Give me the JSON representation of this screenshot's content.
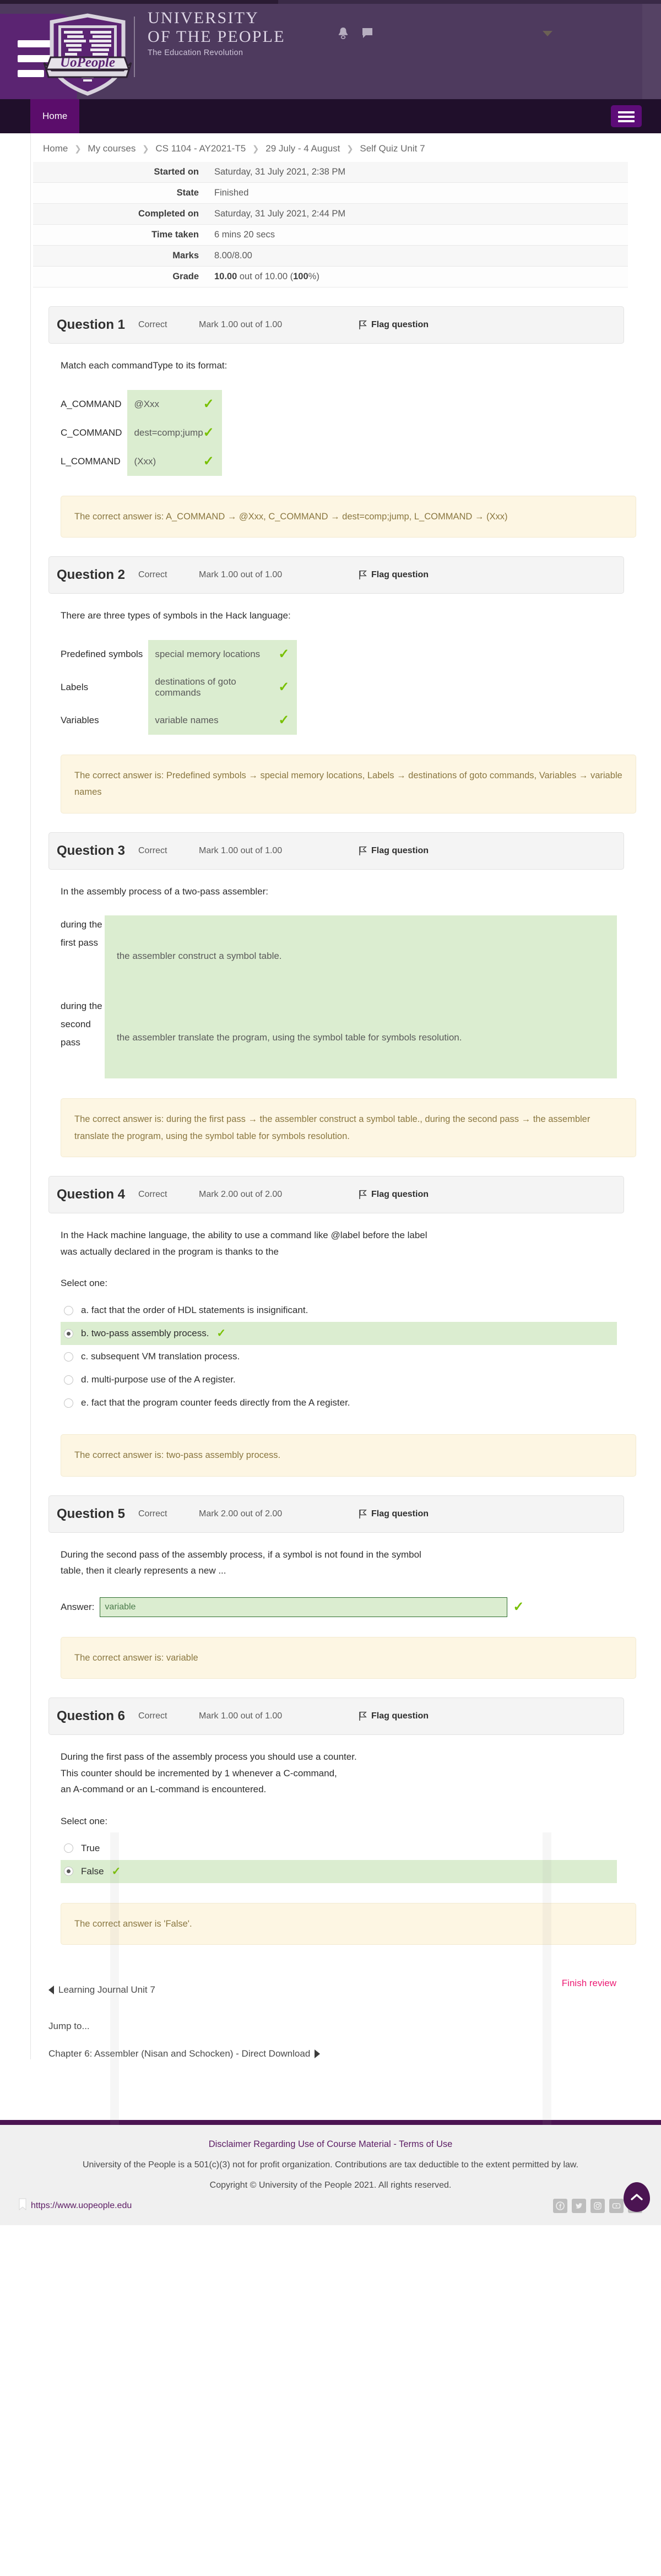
{
  "header": {
    "brand_line1": "UNIVERSITY",
    "brand_line2": "OF THE PEOPLE",
    "tagline": "The Education Revolution",
    "logo_text": "UoPeople",
    "icons": [
      "bell-icon",
      "message-icon",
      "chevron-down-icon"
    ]
  },
  "nav": {
    "home_label": "Home",
    "menu_icon": "hamburger-icon"
  },
  "breadcrumb": [
    "Home",
    "My courses",
    "CS 1104 - AY2021-T5",
    "29 July - 4 August",
    "Self Quiz Unit 7"
  ],
  "summary": {
    "rows": [
      {
        "label": "Started on",
        "value": "Saturday, 31 July 2021, 2:38 PM"
      },
      {
        "label": "State",
        "value": "Finished"
      },
      {
        "label": "Completed on",
        "value": "Saturday, 31 July 2021, 2:44 PM"
      },
      {
        "label": "Time taken",
        "value": "6 mins 20 secs"
      },
      {
        "label": "Marks",
        "value": "8.00/8.00"
      }
    ],
    "grade": {
      "label": "Grade",
      "value_bold": "10.00",
      "value_mid": " out of 10.00 (",
      "value_pct": "100",
      "value_end": "%)"
    }
  },
  "common": {
    "state_correct": "Correct",
    "flag_label": "Flag question",
    "select_one": "Select one:",
    "answer_label": "Answer:"
  },
  "questions": [
    {
      "number": "Question 1",
      "state": "Correct",
      "mark": "Mark 1.00 out of 1.00",
      "flag": "Flag question",
      "prompt": "Match each commandType to its format:",
      "type": "match",
      "pairs": [
        {
          "key": "A_COMMAND",
          "value": "@Xxx"
        },
        {
          "key": "C_COMMAND",
          "value": "dest=comp;jump"
        },
        {
          "key": "L_COMMAND",
          "value": "(Xxx)"
        }
      ],
      "feedback": "The correct answer is: A_COMMAND → @Xxx, C_COMMAND → dest=comp;jump, L_COMMAND → (Xxx)"
    },
    {
      "number": "Question 2",
      "state": "Correct",
      "mark": "Mark 1.00 out of 1.00",
      "flag": "Flag question",
      "prompt": "There are three types of symbols in the Hack language:",
      "type": "match",
      "pairs": [
        {
          "key": "Predefined symbols",
          "value": "special memory locations"
        },
        {
          "key": "Labels",
          "value": "destinations of goto commands"
        },
        {
          "key": "Variables",
          "value": "variable names"
        }
      ],
      "feedback": "The correct answer is: Predefined symbols → special memory locations, Labels → destinations of goto commands, Variables → variable names"
    },
    {
      "number": "Question 3",
      "state": "Correct",
      "mark": "Mark 1.00 out of 1.00",
      "flag": "Flag question",
      "prompt": "In the assembly process of a two-pass assembler:",
      "type": "match-wrap",
      "pairs": [
        {
          "key": "during the first pass",
          "value": "the assembler construct a symbol table."
        },
        {
          "key": "during the second pass",
          "value": "the assembler translate the program, using the symbol table for symbols resolution."
        }
      ],
      "feedback": "The correct answer is: during the first pass → the assembler construct a symbol table., during the second pass → the assembler translate the program, using the symbol table for symbols resolution."
    },
    {
      "number": "Question 4",
      "state": "Correct",
      "mark": "Mark 2.00 out of 2.00",
      "flag": "Flag question",
      "prompt_line1": "In the Hack machine language, the ability to use a command like @label before the label",
      "prompt_line2": "was actually declared in the program is thanks to the",
      "type": "radio",
      "select_one": "Select one:",
      "options": [
        {
          "label": "a. fact that the order of HDL statements is insignificant.",
          "selected": false,
          "correct": false
        },
        {
          "label": "b. two-pass assembly process.",
          "selected": true,
          "correct": true
        },
        {
          "label": "c. subsequent VM translation process.",
          "selected": false,
          "correct": false
        },
        {
          "label": "d. multi-purpose use of the A register.",
          "selected": false,
          "correct": false
        },
        {
          "label": "e. fact that the program counter feeds directly from the A register.",
          "selected": false,
          "correct": false
        }
      ],
      "feedback": "The correct answer is: two-pass assembly process."
    },
    {
      "number": "Question 5",
      "state": "Correct",
      "mark": "Mark 2.00 out of 2.00",
      "flag": "Flag question",
      "prompt_line1": "During the second pass of the assembly process, if a symbol is not found in the symbol",
      "prompt_line2": "table, then it clearly represents a new ...",
      "type": "shortanswer",
      "answer_label": "Answer:",
      "answer_value": "variable",
      "feedback": "The correct answer is: variable"
    },
    {
      "number": "Question 6",
      "state": "Correct",
      "mark": "Mark 1.00 out of 1.00",
      "flag": "Flag question",
      "prompt_line1": "During the first pass of the assembly process you should use a counter.",
      "prompt_line2": "This counter should be incremented by 1 whenever a C-command,",
      "prompt_line3": "an A-command or an L-command is encountered.",
      "type": "radio",
      "select_one": "Select one:",
      "options": [
        {
          "label": "True",
          "selected": false,
          "correct": false
        },
        {
          "label": "False",
          "selected": true,
          "correct": true
        }
      ],
      "feedback": "The correct answer is 'False'."
    }
  ],
  "bottom_nav": {
    "prev_label": "Learning Journal Unit 7",
    "finish_label": "Finish review",
    "jump_label": "Jump to...",
    "next_label": "Chapter 6: Assembler (Nisan and Schocken) - Direct Download"
  },
  "footer": {
    "disclaimer_link": "Disclaimer Regarding Use of Course Material",
    "separator": "-",
    "terms_link": "Terms of Use",
    "body": "University of the People is a 501(c)(3) not for profit organization. Contributions are tax deductible to the extent permitted by law.",
    "copyright": "Copyright © University of the People 2021. All rights reserved.",
    "url": "https://www.uopeople.edu",
    "social": [
      "facebook-icon",
      "twitter-icon",
      "instagram-icon",
      "youtube-icon",
      "linkedin-icon"
    ],
    "to_top_icon": "chevron-up-icon"
  },
  "colors": {
    "header_purple": "#4e3a5e",
    "nav_dark": "#200f2b",
    "nav_active": "#5b0d6b",
    "correct_green": "#dbedd0",
    "tick_green": "#78c000",
    "feedback_cream": "#fdf6e3",
    "finish_pink": "#ec1a73",
    "footer_purple": "#4b1452"
  }
}
